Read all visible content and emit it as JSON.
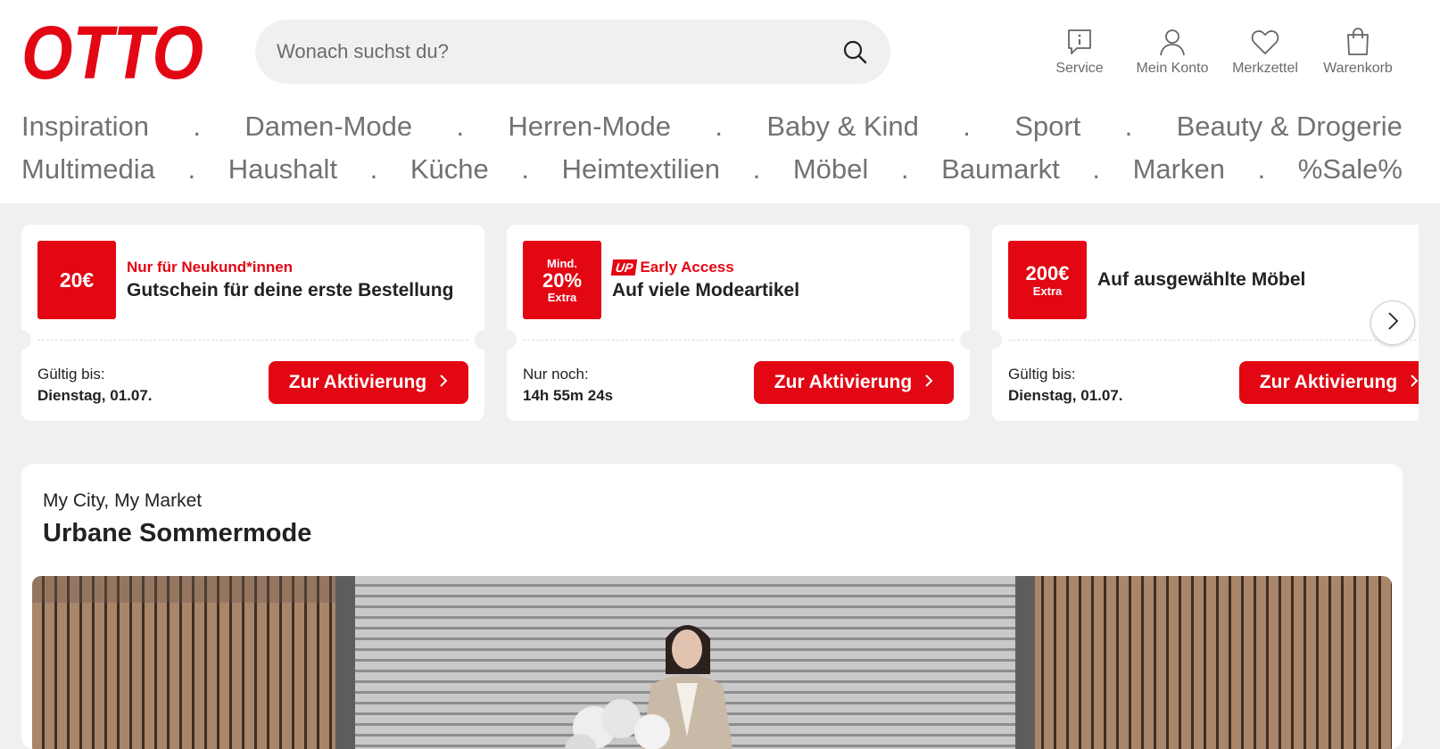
{
  "brand": {
    "logo_text": "OTTO",
    "color": "#e30613"
  },
  "search": {
    "placeholder": "Wonach suchst du?"
  },
  "actions": [
    {
      "label": "Service",
      "icon": "service-info-icon"
    },
    {
      "label": "Mein Konto",
      "icon": "user-icon"
    },
    {
      "label": "Merkzettel",
      "icon": "heart-icon"
    },
    {
      "label": "Warenkorb",
      "icon": "shopping-bag-icon"
    }
  ],
  "nav": {
    "separator": ".",
    "row1": [
      "Inspiration",
      "Damen-Mode",
      "Herren-Mode",
      "Baby & Kind",
      "Sport",
      "Beauty & Drogerie"
    ],
    "row2": [
      "Multimedia",
      "Haushalt",
      "Küche",
      "Heimtextilien",
      "Möbel",
      "Baumarkt",
      "Marken",
      "%Sale%"
    ]
  },
  "coupons": [
    {
      "badge_main": "20€",
      "kicker": "Nur für Neukund*innen",
      "title": "Gutschein für deine erste Bestellung",
      "valid_label": "Gültig bis:",
      "valid_value": "Dienstag, 01.07.",
      "cta": "Zur Aktivierung"
    },
    {
      "badge_top": "Mind.",
      "badge_main": "20%",
      "badge_bottom": "Extra",
      "up_logo": "UP",
      "kicker": "Early Access",
      "title": "Auf viele Modeartikel",
      "valid_label": "Nur noch:",
      "valid_value": "14h 55m 24s",
      "cta": "Zur Aktivierung"
    },
    {
      "badge_main": "200€",
      "badge_bottom": "Extra",
      "title": "Auf ausgewählte Möbel",
      "valid_label": "Gültig bis:",
      "valid_value": "Dienstag, 01.07.",
      "cta": "Zur Aktivierung"
    }
  ],
  "teaser": {
    "kicker": "My City, My Market",
    "headline": "Urbane Sommermode"
  }
}
